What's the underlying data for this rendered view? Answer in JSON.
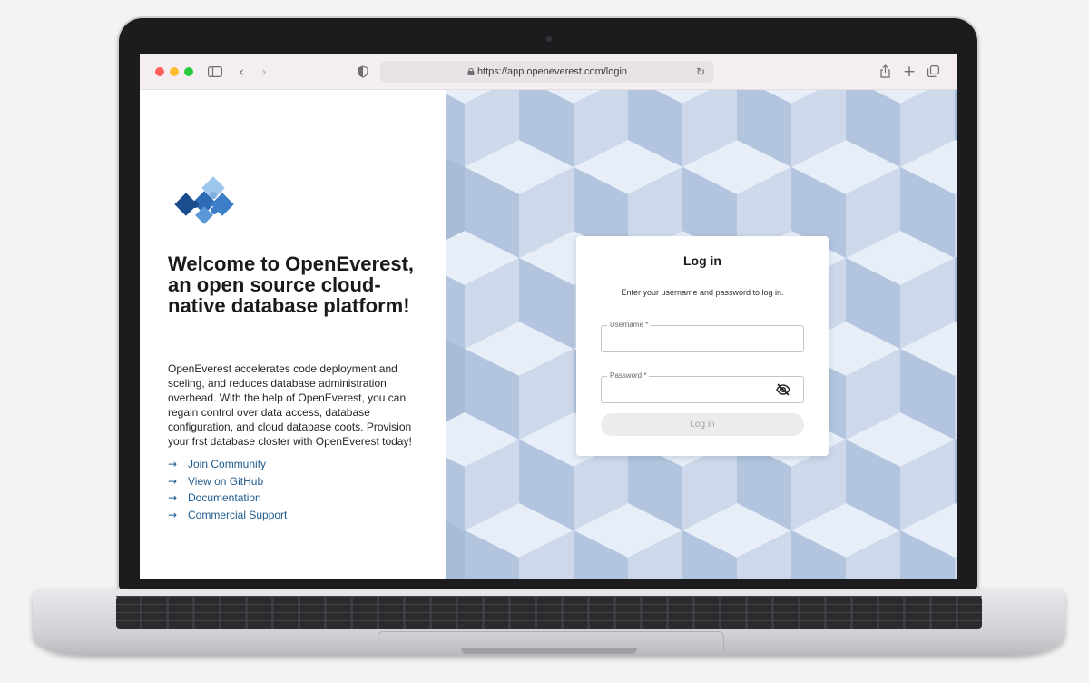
{
  "browser": {
    "url": "https://app.openeverest.com/login",
    "icons": [
      "sidebar-icon",
      "back-icon",
      "forward-icon",
      "privacy-shield-icon",
      "lock-icon",
      "reload-icon",
      "share-icon",
      "new-tab-icon",
      "tabs-overview-icon"
    ]
  },
  "welcome": {
    "heading": "Welcome to OpenEverest, an open source cloud-native database platform!",
    "description": "OpenEverest accelerates code deployment and sceling, and reduces database administration overhead. With the help of OpenEverest, you can regain control over data access, database configuration, and cloud database coots. Provision your frst database closter with OpenEverest today!",
    "links": [
      {
        "label": "Join Community"
      },
      {
        "label": "View on GitHub"
      },
      {
        "label": "Documentation"
      },
      {
        "label": "Commercial Support"
      }
    ]
  },
  "login": {
    "title": "Log in",
    "subtitle": "Enter your username and password to log in.",
    "username_label": "Username *",
    "username_value": "",
    "password_label": "Password *",
    "password_value": "",
    "button_label": "Log in"
  },
  "colors": {
    "traffic_red": "#ff5f57",
    "traffic_yellow": "#febc2e",
    "traffic_green": "#28c840",
    "link": "#1f5b8e",
    "logo_dark": "#1b4d8e",
    "logo_light": "#7fb0e0"
  }
}
